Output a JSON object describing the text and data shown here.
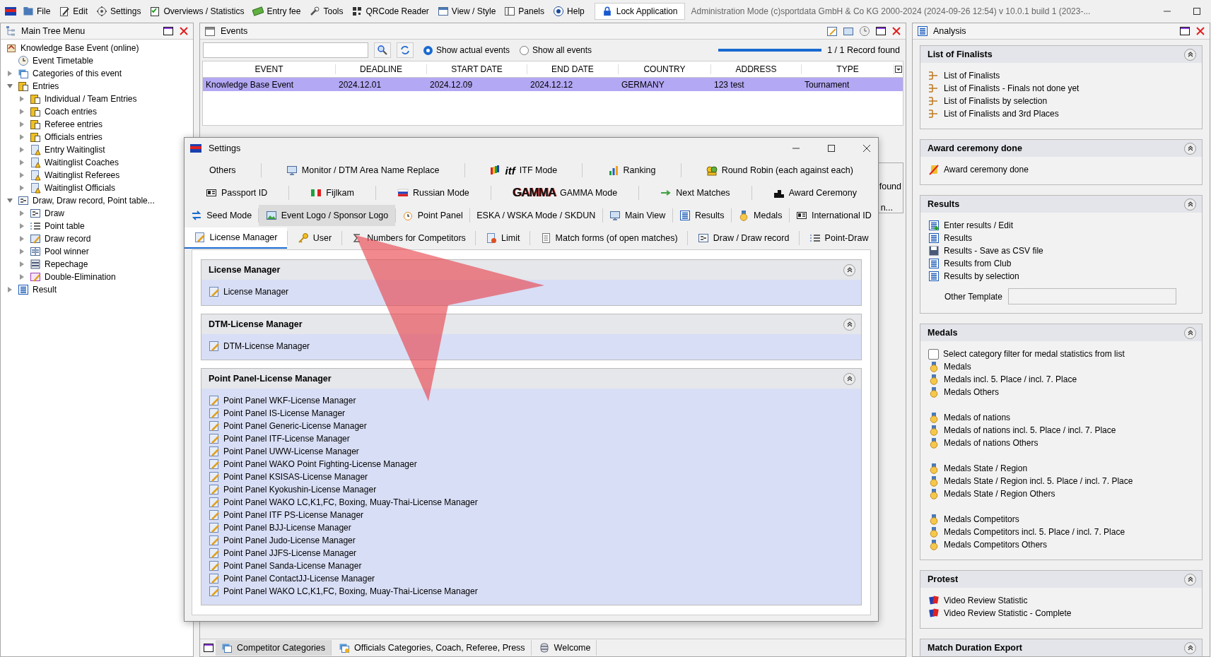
{
  "menu_bar": {
    "items": [
      {
        "label": "File",
        "kind": "folder"
      },
      {
        "label": "Edit",
        "kind": "edit"
      },
      {
        "label": "Settings",
        "kind": "gear"
      },
      {
        "label": "Overviews / Statistics",
        "kind": "checklist"
      },
      {
        "label": "Entry fee",
        "kind": "money"
      },
      {
        "label": "Tools",
        "kind": "wrench"
      },
      {
        "label": "QRCode Reader",
        "kind": "qr"
      },
      {
        "label": "View / Style",
        "kind": "window"
      },
      {
        "label": "Panels",
        "kind": "panels"
      },
      {
        "label": "Help",
        "kind": "help"
      }
    ],
    "lock_button": {
      "label": "Lock Application"
    },
    "title": "Administration Mode (c)sportdata GmbH & Co KG 2000-2024 (2024-09-26 12:54)  v 10.0.1 build 1 (2023-..."
  },
  "main_tree": {
    "title": "Main Tree Menu",
    "root": {
      "label": "Knowledge Base Event (online)",
      "kind": "house",
      "children": [
        {
          "label": "Event Timetable",
          "kind": "clock"
        },
        {
          "label": "Categories of this event",
          "kind": "folders",
          "expanded": false
        },
        {
          "label": "Entries",
          "kind": "clipboard",
          "expanded": true,
          "children": [
            {
              "label": "Individual / Team Entries",
              "kind": "clipboard",
              "expanded": false
            },
            {
              "label": "Coach entries",
              "kind": "clipboard",
              "expanded": false
            },
            {
              "label": "Referee entries",
              "kind": "clipboard",
              "expanded": false
            },
            {
              "label": "Officials entries",
              "kind": "clipboard",
              "expanded": false
            },
            {
              "label": "Entry Waitinglist",
              "kind": "doc-warn",
              "expanded": false
            },
            {
              "label": "Waitinglist Coaches",
              "kind": "doc-warn",
              "expanded": false
            },
            {
              "label": "Waitinglist Referees",
              "kind": "doc-warn",
              "expanded": false
            },
            {
              "label": "Waitinglist Officials",
              "kind": "doc-warn",
              "expanded": false
            }
          ]
        },
        {
          "label": "Draw, Draw record, Point table...",
          "kind": "draw",
          "expanded": true,
          "children": [
            {
              "label": "Draw",
              "kind": "draw",
              "expanded": false
            },
            {
              "label": "Point table",
              "kind": "numlist",
              "expanded": false
            },
            {
              "label": "Draw record",
              "kind": "pencil-doc",
              "expanded": false
            },
            {
              "label": "Pool winner",
              "kind": "grid",
              "expanded": false
            },
            {
              "label": "Repechage",
              "kind": "bars",
              "expanded": false
            },
            {
              "label": "Double-Elimination",
              "kind": "double",
              "expanded": false
            }
          ]
        },
        {
          "label": "Result",
          "kind": "table",
          "expanded": false
        }
      ]
    }
  },
  "events": {
    "title": "Events",
    "radios": [
      {
        "label": "Show actual events",
        "selected": true
      },
      {
        "label": "Show all events",
        "selected": false
      }
    ],
    "progress": {
      "level": 1
    },
    "record_count": "1 / 1 Record found",
    "table": {
      "columns": [
        "EVENT",
        "DEADLINE",
        "START DATE",
        "END DATE",
        "COUNTRY",
        "ADDRESS",
        "TYPE"
      ],
      "rows": [
        {
          "cells": [
            "Knowledge Base Event",
            "2024.12.01",
            "2024.12.09",
            "2024.12.12",
            "GERMANY",
            "123 test",
            "Tournament"
          ],
          "selected": true
        }
      ]
    },
    "bottom_tabs": [
      {
        "label": "Competitor Categories",
        "kind": "folders",
        "selected": true
      },
      {
        "label": "Officials Categories, Coach, Referee, Press",
        "kind": "folders-star",
        "selected": false
      },
      {
        "label": "Welcome",
        "kind": "database",
        "selected": false
      }
    ]
  },
  "background_window": {
    "status_text": "found",
    "tab_text": "n..."
  },
  "settings_dialog": {
    "title": "Settings",
    "tab_rows": [
      [
        {
          "label": "Others",
          "selected": false,
          "hovered": false
        },
        {
          "label": "Monitor / DTM Area Name Replace",
          "kind": "monitor",
          "selected": false,
          "hovered": false
        },
        {
          "label": "ITF Mode",
          "kind": "itf",
          "logo": "itf",
          "selected": false,
          "hovered": false
        },
        {
          "label": "Ranking",
          "kind": "barchart",
          "selected": false,
          "hovered": false
        },
        {
          "label": "Round Robin (each against each)",
          "kind": "group",
          "selected": false,
          "hovered": false
        }
      ],
      [
        {
          "label": "Passport ID",
          "kind": "idcard",
          "selected": false,
          "hovered": false
        },
        {
          "label": "Fijlkam",
          "kind": "flag-it",
          "selected": false,
          "hovered": false
        },
        {
          "label": "Russian Mode",
          "kind": "flag-ru",
          "selected": false,
          "hovered": false
        },
        {
          "label": "GAMMA Mode",
          "kind": "gamma",
          "logo": "GAMMA",
          "selected": false,
          "hovered": false
        },
        {
          "label": "Next Matches",
          "kind": "arrow",
          "selected": false,
          "hovered": false
        },
        {
          "label": "Award Ceremony",
          "kind": "podium",
          "selected": false,
          "hovered": false
        }
      ],
      [
        {
          "label": "Seed Mode",
          "kind": "seed",
          "selected": false,
          "hovered": false
        },
        {
          "label": "Event Logo / Sponsor Logo",
          "kind": "image",
          "selected": false,
          "hovered": true
        },
        {
          "label": "Point Panel",
          "kind": "timer",
          "selected": false,
          "hovered": false
        },
        {
          "label": "ESKA / WSKA Mode / SKDUN",
          "selected": false,
          "hovered": false
        },
        {
          "label": "Main View",
          "kind": "monitor",
          "selected": false,
          "hovered": false
        },
        {
          "label": "Results",
          "kind": "table",
          "selected": false,
          "hovered": false
        },
        {
          "label": "Medals",
          "kind": "medal",
          "selected": false,
          "hovered": false
        },
        {
          "label": "International ID",
          "kind": "idcard",
          "selected": false,
          "hovered": false
        }
      ],
      [
        {
          "label": "License Manager",
          "kind": "license",
          "selected": true,
          "hovered": false
        },
        {
          "label": "User",
          "kind": "key",
          "selected": false,
          "hovered": false
        },
        {
          "label": "Numbers for Competitors",
          "kind": "sigma",
          "selected": false,
          "hovered": false
        },
        {
          "label": "Limit",
          "kind": "doc-stop",
          "selected": false,
          "hovered": false
        },
        {
          "label": "Match forms (of open matches)",
          "kind": "document",
          "selected": false,
          "hovered": false
        },
        {
          "label": "Draw / Draw record",
          "kind": "draw",
          "selected": false,
          "hovered": false
        },
        {
          "label": "Point-Draw",
          "kind": "numlist",
          "selected": false,
          "hovered": false
        }
      ]
    ],
    "sections": [
      {
        "title": "License Manager",
        "expanded": true,
        "items": [
          "License Manager"
        ]
      },
      {
        "title": "DTM-License Manager",
        "expanded": true,
        "items": [
          "DTM-License Manager"
        ]
      },
      {
        "title": "Point Panel-License Manager",
        "expanded": true,
        "items": [
          "Point Panel WKF-License Manager",
          "Point Panel IS-License Manager",
          "Point Panel Generic-License Manager",
          "Point Panel ITF-License Manager",
          "Point Panel UWW-License Manager",
          "Point Panel WAKO Point Fighting-License Manager",
          "Point Panel KSISAS-License Manager",
          "Point Panel Kyokushin-License Manager",
          "Point Panel WAKO LC,K1,FC, Boxing, Muay-Thai-License Manager",
          "Point Panel ITF PS-License Manager",
          "Point Panel BJJ-License Manager",
          "Point Panel Judo-License Manager",
          "Point Panel JJFS-License Manager",
          "Point Panel Sanda-License Manager",
          "Point Panel ContactJJ-License Manager",
          "Point Panel WAKO LC,K1,FC, Boxing, Muay-Thai-License Manager"
        ]
      }
    ]
  },
  "analysis": {
    "title": "Analysis",
    "sections": [
      {
        "title": "List of Finalists",
        "expanded": true,
        "groups": [
          [
            {
              "label": "List of Finalists",
              "kind": "branch"
            },
            {
              "label": "List of Finalists - Finals not done yet",
              "kind": "branch"
            },
            {
              "label": "List of Finalists by selection",
              "kind": "branch"
            },
            {
              "label": "List of Finalists and 3rd Places",
              "kind": "branch"
            }
          ]
        ]
      },
      {
        "title": "Award ceremony done",
        "expanded": true,
        "groups": [
          [
            {
              "label": "Award ceremony done",
              "kind": "award-done"
            }
          ]
        ]
      },
      {
        "title": "Results",
        "expanded": true,
        "groups": [
          [
            {
              "label": "Enter results / Edit",
              "kind": "table-add"
            },
            {
              "label": "Results",
              "kind": "table"
            },
            {
              "label": "Results - Save as CSV file",
              "kind": "disk"
            },
            {
              "label": "Results from Club",
              "kind": "table"
            },
            {
              "label": "Results by selection",
              "kind": "table"
            }
          ]
        ],
        "template_field": {
          "label": "Other Template"
        }
      },
      {
        "title": "Medals",
        "expanded": true,
        "checkbox": {
          "label": "Select category filter for medal statistics from list",
          "checked": false
        },
        "groups": [
          [
            {
              "label": "Medals",
              "kind": "medal"
            },
            {
              "label": "Medals incl. 5. Place / incl. 7. Place",
              "kind": "medal"
            },
            {
              "label": "Medals Others",
              "kind": "medal"
            }
          ],
          [
            {
              "label": "Medals of nations",
              "kind": "medal"
            },
            {
              "label": "Medals of nations incl. 5. Place / incl. 7. Place",
              "kind": "medal"
            },
            {
              "label": "Medals of nations Others",
              "kind": "medal"
            }
          ],
          [
            {
              "label": "Medals State / Region",
              "kind": "medal"
            },
            {
              "label": "Medals State / Region incl. 5. Place / incl. 7. Place",
              "kind": "medal"
            },
            {
              "label": "Medals State / Region Others",
              "kind": "medal"
            }
          ],
          [
            {
              "label": "Medals Competitors",
              "kind": "medal"
            },
            {
              "label": "Medals Competitors incl. 5. Place / incl. 7. Place",
              "kind": "medal"
            },
            {
              "label": "Medals Competitors Others",
              "kind": "medal"
            }
          ]
        ]
      },
      {
        "title": "Protest",
        "expanded": true,
        "groups": [
          [
            {
              "label": "Video Review Statistic",
              "kind": "cards"
            },
            {
              "label": "Video Review Statistic - Complete",
              "kind": "cards"
            }
          ]
        ]
      },
      {
        "title": "Match Duration Export",
        "expanded": true
      }
    ]
  }
}
